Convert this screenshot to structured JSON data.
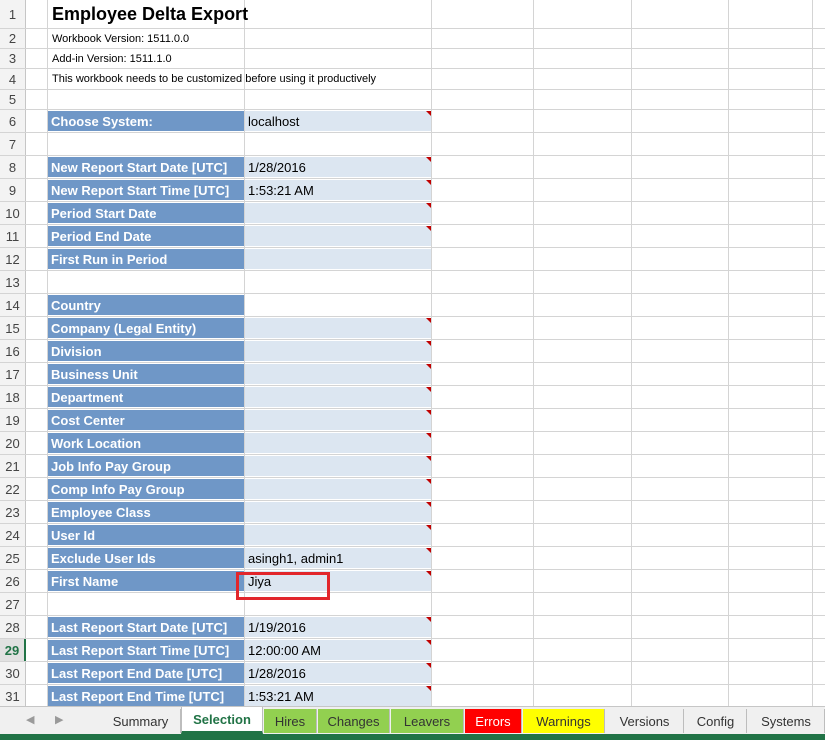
{
  "sheet": {
    "title": "Employee Delta Export",
    "workbook_version": "Workbook Version: 1511.0.0",
    "addin_version": "Add-in Version: 1511.1.0",
    "notice": "This workbook needs to be customized before using it productively",
    "active_row": "29",
    "row_numbers": [
      "1",
      "2",
      "3",
      "4",
      "5",
      "6",
      "7",
      "8",
      "9",
      "10",
      "11",
      "12",
      "13",
      "14",
      "15",
      "16",
      "17",
      "18",
      "19",
      "20",
      "21",
      "22",
      "23",
      "24",
      "25",
      "26",
      "27",
      "28",
      "29",
      "30",
      "31"
    ],
    "fields": {
      "choose_system": {
        "label": "Choose System:",
        "value": "localhost"
      },
      "new_report_start_date": {
        "label": "New Report Start Date [UTC]",
        "value": "1/28/2016"
      },
      "new_report_start_time": {
        "label": "New Report Start Time [UTC]",
        "value": "1:53:21 AM"
      },
      "period_start_date": {
        "label": "Period Start Date",
        "value": ""
      },
      "period_end_date": {
        "label": "Period End Date",
        "value": ""
      },
      "first_run_in_period": {
        "label": "First Run in Period",
        "value": ""
      },
      "country": {
        "label": "Country",
        "value": ""
      },
      "company": {
        "label": "Company (Legal Entity)",
        "value": ""
      },
      "division": {
        "label": "Division",
        "value": ""
      },
      "business_unit": {
        "label": "Business Unit",
        "value": ""
      },
      "department": {
        "label": "Department",
        "value": ""
      },
      "cost_center": {
        "label": "Cost Center",
        "value": ""
      },
      "work_location": {
        "label": "Work Location",
        "value": ""
      },
      "job_info_pay_group": {
        "label": "Job Info Pay Group",
        "value": ""
      },
      "comp_info_pay_group": {
        "label": "Comp Info Pay Group",
        "value": ""
      },
      "employee_class": {
        "label": "Employee Class",
        "value": ""
      },
      "user_id": {
        "label": "User Id",
        "value": ""
      },
      "exclude_user_ids": {
        "label": "Exclude User Ids",
        "value": "asingh1, admin1"
      },
      "first_name": {
        "label": "First Name",
        "value": "Jiya"
      },
      "last_report_start_date": {
        "label": "Last Report Start Date [UTC]",
        "value": "1/19/2016"
      },
      "last_report_start_time": {
        "label": "Last Report Start Time [UTC]",
        "value": "12:00:00 AM"
      },
      "last_report_end_date": {
        "label": "Last Report End Date [UTC]",
        "value": "1/28/2016"
      },
      "last_report_end_time": {
        "label": "Last Report End Time [UTC]",
        "value": "1:53:21 AM"
      }
    }
  },
  "tabs": {
    "summary": "Summary",
    "selection": "Selection",
    "hires": "Hires",
    "changes": "Changes",
    "leavers": "Leavers",
    "errors": "Errors",
    "warnings": "Warnings",
    "versions": "Versions",
    "config": "Config",
    "systems": "Systems"
  },
  "colors": {
    "label_fill": "#6f97c7",
    "value_fill": "#dce6f1",
    "hires_tab": "#92d050",
    "errors_tab": "#ff0000",
    "warnings_tab": "#ffff00",
    "excel_green": "#217346"
  }
}
